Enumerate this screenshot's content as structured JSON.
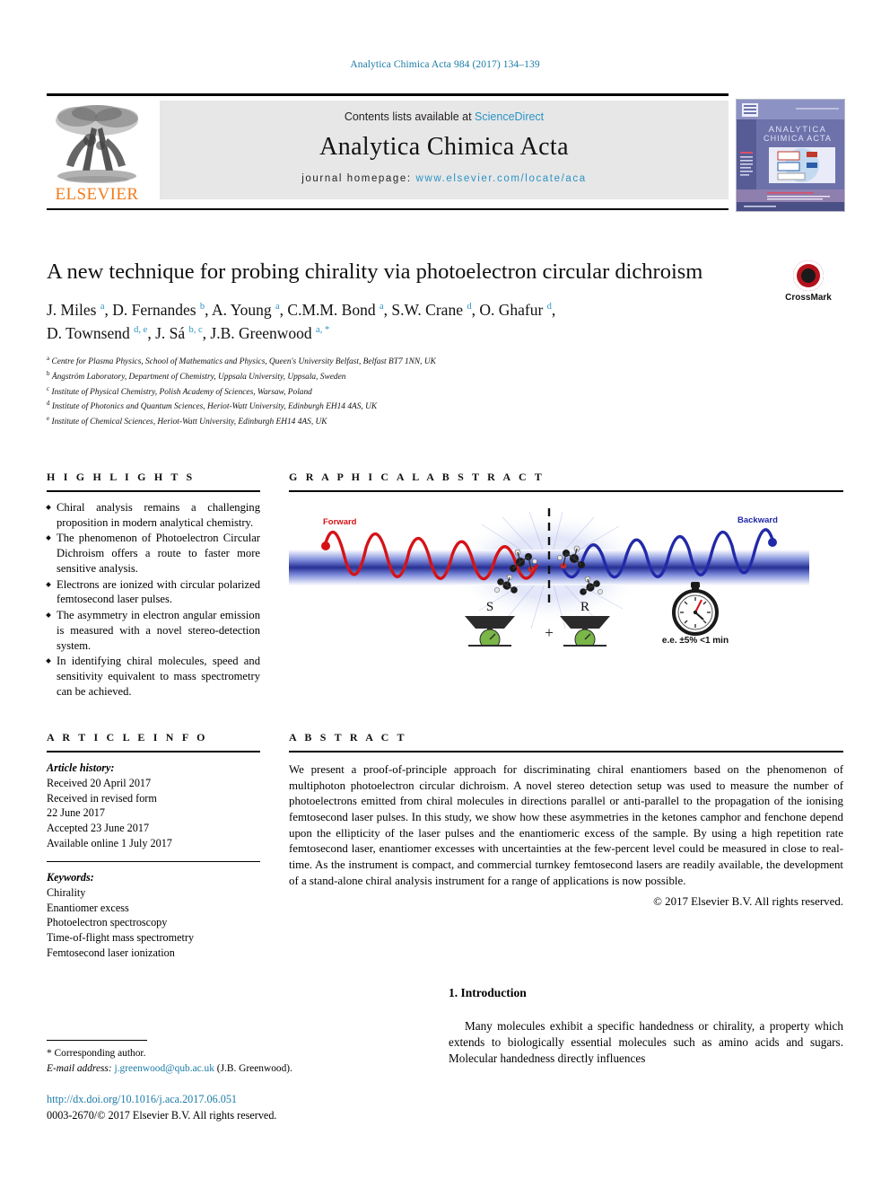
{
  "running_head": "Analytica Chimica Acta 984 (2017) 134–139",
  "masthead": {
    "contents_prefix": "Contents lists available at ",
    "sciencedirect": "ScienceDirect",
    "journal_title": "Analytica Chimica Acta",
    "homepage_prefix": "journal homepage: ",
    "homepage_url": "www.elsevier.com/locate/aca",
    "publisher": "ELSEVIER",
    "publisher_color": "#f07c1b",
    "cover_title_line1": "ANALYTICA",
    "cover_title_line2": "CHIMICA ACTA"
  },
  "crossmark": {
    "label": "CrossMark",
    "color": "#b5121b"
  },
  "article": {
    "title": "A new technique for probing chirality via photoelectron circular dichroism",
    "authors_line1": "J. Miles a, D. Fernandes b, A. Young a, C.M.M. Bond a, S.W. Crane d, O. Ghafur d,",
    "authors_line2": "D. Townsend d, e, J. Sá b, c, J.B. Greenwood a, *",
    "authors": [
      {
        "name": "J. Miles",
        "marks": "a"
      },
      {
        "name": "D. Fernandes",
        "marks": "b"
      },
      {
        "name": "A. Young",
        "marks": "a"
      },
      {
        "name": "C.M.M. Bond",
        "marks": "a"
      },
      {
        "name": "S.W. Crane",
        "marks": "d"
      },
      {
        "name": "O. Ghafur",
        "marks": "d"
      },
      {
        "name": "D. Townsend",
        "marks": "d, e"
      },
      {
        "name": "J. Sá",
        "marks": "b, c"
      },
      {
        "name": "J.B. Greenwood",
        "marks": "a, *"
      }
    ],
    "affiliations": [
      {
        "mark": "a",
        "text": "Centre for Plasma Physics, School of Mathematics and Physics, Queen's University Belfast, Belfast BT7 1NN, UK"
      },
      {
        "mark": "b",
        "text": "Ångström Laboratory, Department of Chemistry, Uppsala University, Uppsala, Sweden"
      },
      {
        "mark": "c",
        "text": "Institute of Physical Chemistry, Polish Academy of Sciences, Warsaw, Poland"
      },
      {
        "mark": "d",
        "text": "Institute of Photonics and Quantum Sciences, Heriot-Watt University, Edinburgh EH14 4AS, UK"
      },
      {
        "mark": "e",
        "text": "Institute of Chemical Sciences, Heriot-Watt University, Edinburgh EH14 4AS, UK"
      }
    ]
  },
  "highlights": {
    "heading": "H I G H L I G H T S",
    "items": [
      "Chiral analysis remains a challenging proposition in modern analytical chemistry.",
      "The phenomenon of Photoelectron Circular Dichroism offers a route to faster more sensitive analysis.",
      "Electrons are ionized with circular polarized femtosecond laser pulses.",
      "The asymmetry in electron angular emission is measured with a novel stereo-detection system.",
      "In identifying chiral molecules, speed and sensitivity equivalent to mass spectrometry can be achieved."
    ]
  },
  "graphical_abstract": {
    "heading": "G R A P H I C A L   A B S T R A C T",
    "labels": {
      "forward": "Forward",
      "backward": "Backward",
      "scale_s": "S",
      "scale_r": "R",
      "plus": "+",
      "stopwatch_caption": "e.e. ±5% <1 min"
    },
    "colors": {
      "forward_wave": "#d51317",
      "backward_wave": "#2229a8",
      "beam": "#1d2f9e",
      "pan": "#7ab648"
    }
  },
  "article_info": {
    "heading": "A R T I C L E   I N F O",
    "history_label": "Article history:",
    "history": [
      "Received 20 April 2017",
      "Received in revised form",
      "22 June 2017",
      "Accepted 23 June 2017",
      "Available online 1 July 2017"
    ],
    "keywords_label": "Keywords:",
    "keywords": [
      "Chirality",
      "Enantiomer excess",
      "Photoelectron spectroscopy",
      "Time-of-flight mass spectrometry",
      "Femtosecond laser ionization"
    ]
  },
  "abstract": {
    "heading": "A B S T R A C T",
    "body": "We present a proof-of-principle approach for discriminating chiral enantiomers based on the phenomenon of multiphoton photoelectron circular dichroism. A novel stereo detection setup was used to measure the number of photoelectrons emitted from chiral molecules in directions parallel or anti-parallel to the propagation of the ionising femtosecond laser pulses. In this study, we show how these asymmetries in the ketones camphor and fenchone depend upon the ellipticity of the laser pulses and the enantiomeric excess of the sample. By using a high repetition rate femtosecond laser, enantiomer excesses with uncertainties at the few-percent level could be measured in close to real-time. As the instrument is compact, and commercial turnkey femtosecond lasers are readily available, the development of a stand-alone chiral analysis instrument for a range of applications is now possible.",
    "copyright": "© 2017 Elsevier B.V. All rights reserved."
  },
  "introduction": {
    "heading": "1.  Introduction",
    "paragraph": "Many molecules exhibit a specific handedness or chirality, a property which extends to biologically essential molecules such as amino acids and sugars. Molecular handedness directly influences"
  },
  "footnote": {
    "corresponding": "* Corresponding author.",
    "email_label": "E-mail address:",
    "email": "j.greenwood@qub.ac.uk",
    "email_owner": "(J.B. Greenwood)."
  },
  "footer": {
    "doi": "http://dx.doi.org/10.1016/j.aca.2017.06.051",
    "issn_line": "0003-2670/© 2017 Elsevier B.V. All rights reserved."
  }
}
